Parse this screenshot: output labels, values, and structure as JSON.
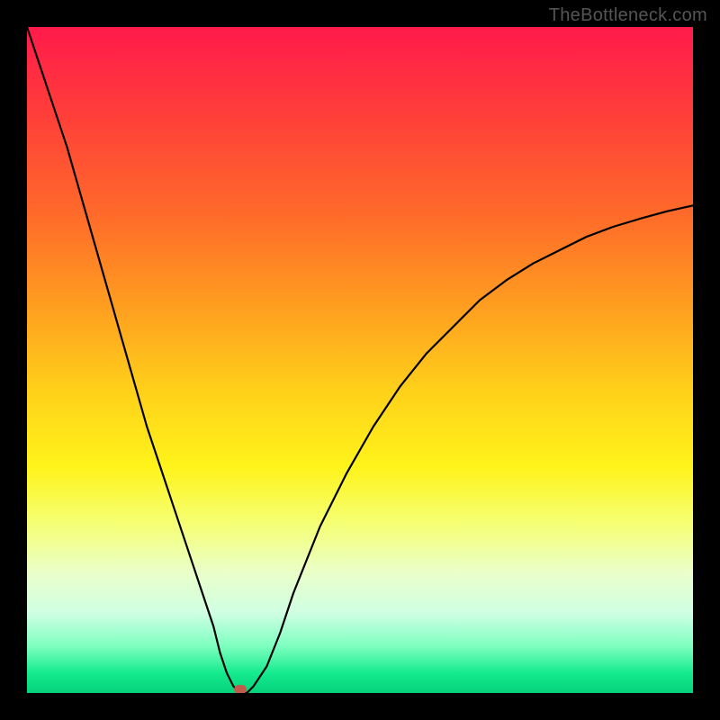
{
  "watermark": "TheBottleneck.com",
  "marker_color": "#c05a4a",
  "chart_data": {
    "type": "line",
    "title": "",
    "xlabel": "",
    "ylabel": "",
    "xlim": [
      0,
      100
    ],
    "ylim": [
      0,
      100
    ],
    "x": [
      0,
      2,
      4,
      6,
      8,
      10,
      12,
      14,
      16,
      18,
      20,
      22,
      24,
      26,
      28,
      29,
      30,
      31,
      32,
      33,
      34,
      36,
      38,
      40,
      44,
      48,
      52,
      56,
      60,
      64,
      68,
      72,
      76,
      80,
      84,
      88,
      92,
      96,
      100
    ],
    "values": [
      100,
      94,
      88,
      82,
      75,
      68,
      61,
      54,
      47,
      40,
      34,
      28,
      22,
      16,
      10,
      6,
      3,
      1,
      0,
      0,
      1,
      4,
      9,
      15,
      25,
      33,
      40,
      46,
      51,
      55,
      59,
      62,
      64.5,
      66.5,
      68.5,
      70,
      71.2,
      72.3,
      73.2
    ],
    "minimum_x": 32,
    "annotations": []
  }
}
